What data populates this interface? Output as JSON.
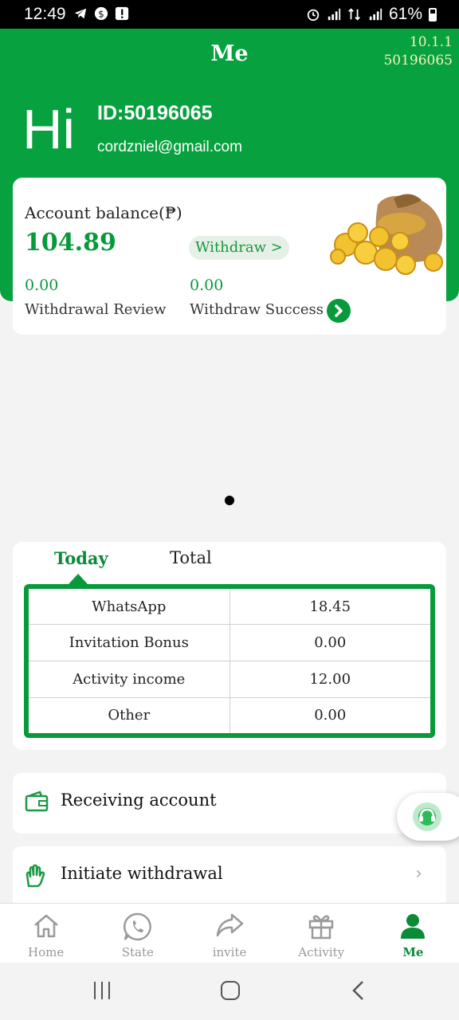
{
  "status_bar": {
    "time": "12:49",
    "battery": "61%"
  },
  "header": {
    "title": "Me",
    "version": "10.1.1",
    "user_code": "50196065",
    "greeting": "Hi",
    "user_id": "ID:50196065",
    "email": "cordzniel@gmail.com",
    "color": "#07a23f"
  },
  "balance": {
    "label": "Account balance(₱)",
    "value": "104.89",
    "withdraw_label": "Withdraw >",
    "review_value": "0.00",
    "review_label": "Withdrawal Review",
    "success_value": "0.00",
    "success_label": "Withdraw Success"
  },
  "income": {
    "tabs": [
      "Today",
      "Total"
    ],
    "active_tab": "Today",
    "rows": [
      {
        "name": "WhatsApp",
        "value": "18.45"
      },
      {
        "name": "Invitation Bonus",
        "value": "0.00"
      },
      {
        "name": "Activity income",
        "value": "12.00"
      },
      {
        "name": "Other",
        "value": "0.00"
      }
    ]
  },
  "menu": {
    "items": [
      {
        "label": "Receiving account",
        "icon": "wallet-icon"
      },
      {
        "label": "Initiate withdrawal",
        "icon": "hand-icon"
      }
    ]
  },
  "bottom_nav": {
    "items": [
      {
        "label": "Home",
        "icon": "home-icon"
      },
      {
        "label": "State",
        "icon": "whatsapp-icon"
      },
      {
        "label": "invite",
        "icon": "share-icon"
      },
      {
        "label": "Activity",
        "icon": "gift-icon"
      },
      {
        "label": "Me",
        "icon": "user-icon"
      }
    ],
    "active": "Me"
  }
}
